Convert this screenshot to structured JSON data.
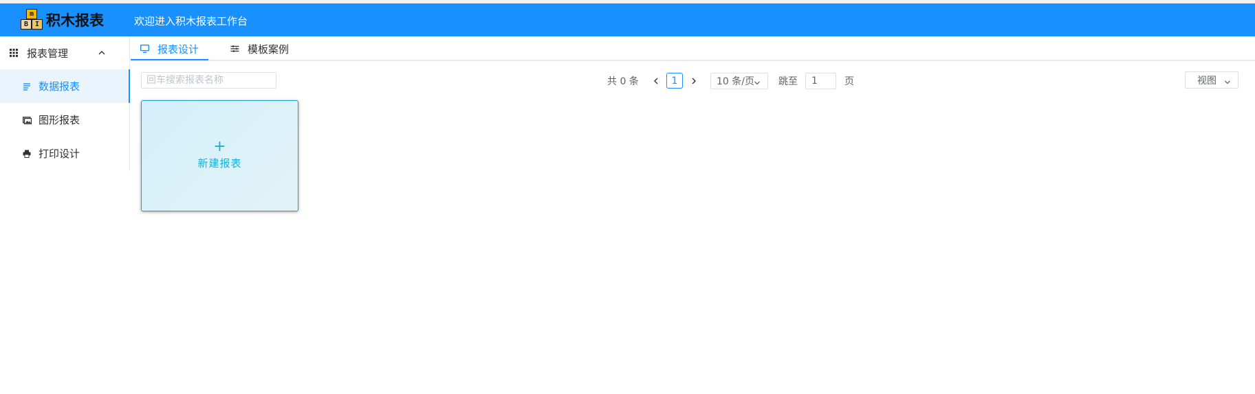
{
  "header": {
    "logo_blocks": {
      "top": "m",
      "bottom_left": "B",
      "bottom_right": "I"
    },
    "logo_text": "积木报表",
    "welcome": "欢迎进入积木报表工作台",
    "bg_color": "#1890ff"
  },
  "sidebar": {
    "group_label": "报表管理",
    "items": [
      {
        "label": "数据报表",
        "icon": "list-icon",
        "active": true
      },
      {
        "label": "图形报表",
        "icon": "image-icon",
        "active": false
      },
      {
        "label": "打印设计",
        "icon": "printer-icon",
        "active": false
      }
    ]
  },
  "tabs": [
    {
      "label": "报表设计",
      "icon": "monitor-icon",
      "active": true
    },
    {
      "label": "模板案例",
      "icon": "sliders-icon",
      "active": false
    }
  ],
  "search": {
    "placeholder": "回车搜索报表名称",
    "value": ""
  },
  "pagination": {
    "total": "共 0 条",
    "current_page": "1",
    "page_size": "10 条/页",
    "jump_label": "跳至",
    "jump_value": "1",
    "page_word": "页"
  },
  "view_button": {
    "label": "视图"
  },
  "new_card": {
    "plus": "+",
    "label": "新建报表"
  },
  "accent_color": "#1890ff"
}
